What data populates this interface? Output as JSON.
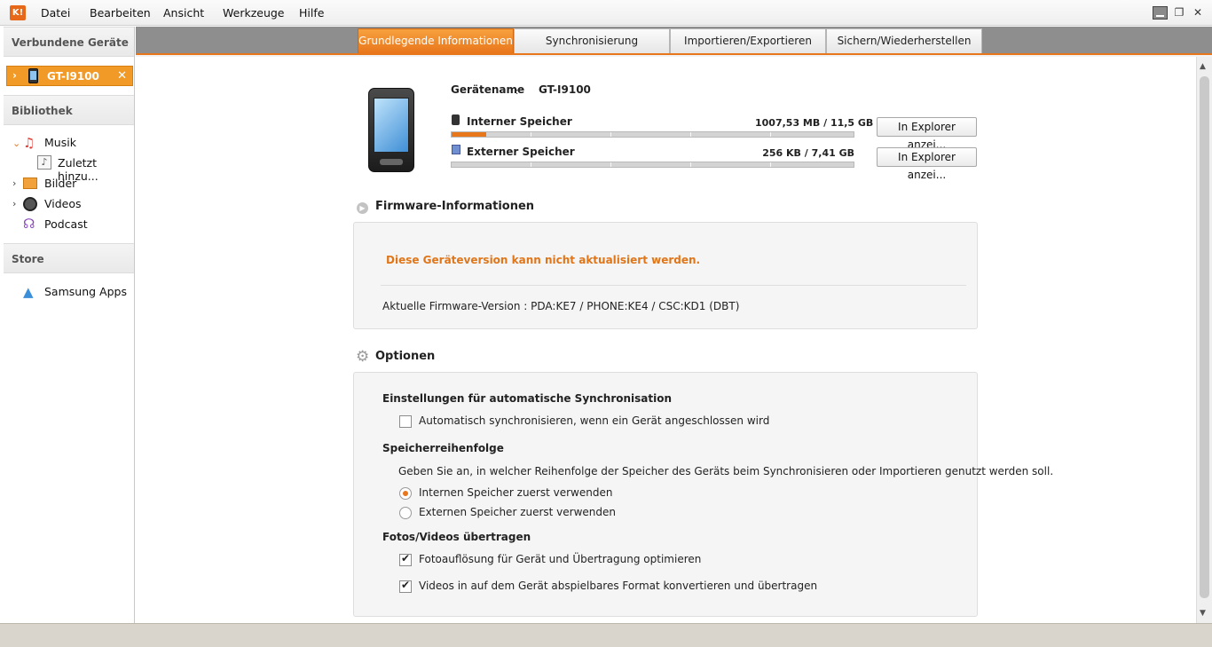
{
  "menu": [
    "Datei",
    "Bearbeiten",
    "Ansicht",
    "Werkzeuge",
    "Hilfe"
  ],
  "app_logo": "K!",
  "sidebar": {
    "connected_header": "Verbundene Geräte",
    "device_name": "GT-I9100",
    "library_header": "Bibliothek",
    "library_items": [
      "Musik",
      "Zuletzt hinzu...",
      "Bilder",
      "Videos",
      "Podcast"
    ],
    "store_header": "Store",
    "store_items": [
      "Samsung Apps"
    ]
  },
  "tabs": [
    "Grundlegende Informationen",
    "Synchronisierung",
    "Importieren/Exportieren",
    "Sichern/Wiederherstellen"
  ],
  "device": {
    "name_label": "Gerätename",
    "name_sep": ":",
    "name": "GT-I9100",
    "internal_label": "Interner Speicher",
    "internal_value": "1007,53 MB / 11,5 GB",
    "internal_fraction": 0.087,
    "external_label": "Externer Speicher",
    "external_value": "256 KB / 7,41 GB",
    "external_fraction": 0.0,
    "explorer_button": "In Explorer anzei..."
  },
  "firmware": {
    "title": "Firmware-Informationen",
    "message": "Diese Geräteversion kann nicht aktualisiert werden.",
    "version": "Aktuelle Firmware-Version : PDA:KE7 / PHONE:KE4 / CSC:KD1 (DBT)"
  },
  "options": {
    "title": "Optionen",
    "auto_sync_header": "Einstellungen für automatische Synchronisation",
    "auto_sync_label": "Automatisch synchronisieren, wenn ein Gerät angeschlossen wird",
    "auto_sync_checked": false,
    "storage_order_header": "Speicherreihenfolge",
    "storage_order_desc": "Geben Sie an, in welcher Reihenfolge der Speicher des Geräts beim Synchronisieren oder Importieren genutzt werden soll.",
    "radio_internal": "Internen Speicher zuerst verwenden",
    "radio_external": "Externen Speicher zuerst verwenden",
    "selected_radio": "internal",
    "transfer_header": "Fotos/Videos übertragen",
    "photo_opt": "Fotoauflösung für Gerät und Übertragung optimieren",
    "photo_opt_checked": true,
    "video_opt": "Videos in auf dem Gerät abspielbares Format konvertieren und übertragen",
    "video_opt_checked": true
  },
  "colors": {
    "accent": "#e8761b",
    "tab_bar": "#8e8e8e"
  }
}
